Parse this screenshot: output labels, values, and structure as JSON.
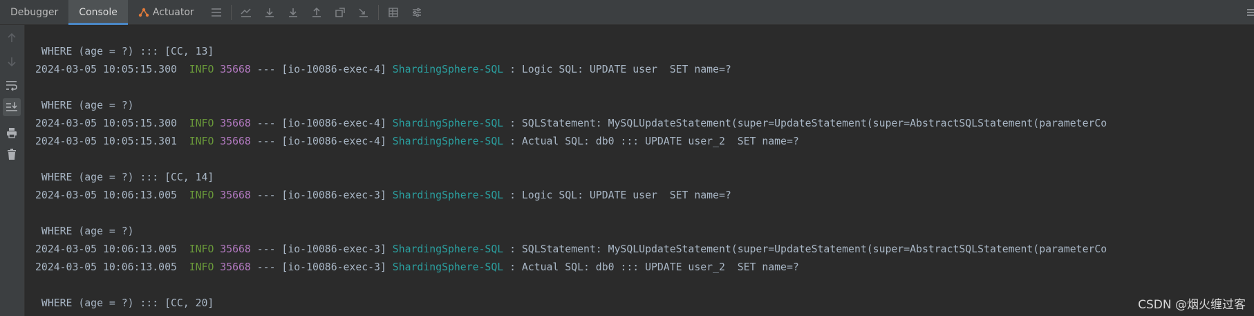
{
  "tabs": {
    "debugger": "Debugger",
    "console": "Console",
    "actuator": "Actuator"
  },
  "colors": {
    "background": "#2b2b2b",
    "info": "#6a9a3a",
    "pid": "#b279c0",
    "logger": "#2aa0a0",
    "text": "#a9b7c6",
    "active_tab_underline": "#4a88c7"
  },
  "toolbar_icons": [
    "menu-icon",
    "restore-layout-icon",
    "step-over-icon",
    "step-into-icon",
    "step-out-icon",
    "run-to-cursor-icon",
    "evaluate-icon",
    "table-icon",
    "settings-list-icon"
  ],
  "gutter_icons": [
    "up-arrow-icon",
    "down-arrow-icon",
    "soft-wrap-icon",
    "scroll-to-end-icon",
    "print-icon",
    "trash-icon"
  ],
  "log": {
    "lines": [
      {
        "type": "text",
        "text": " WHERE (age = ?) ::: [CC, 13]"
      },
      {
        "type": "log",
        "ts": "2024-03-05 10:05:15.300",
        "level": "INFO",
        "pid": "35668",
        "sep": "---",
        "thread": "[io-10086-exec-4]",
        "logger": "ShardingSphere-SQL",
        "msg": ": Logic SQL: UPDATE user  SET name=?"
      },
      {
        "type": "blank",
        "text": ""
      },
      {
        "type": "text",
        "text": " WHERE (age = ?)"
      },
      {
        "type": "log",
        "ts": "2024-03-05 10:05:15.300",
        "level": "INFO",
        "pid": "35668",
        "sep": "---",
        "thread": "[io-10086-exec-4]",
        "logger": "ShardingSphere-SQL",
        "msg": ": SQLStatement: MySQLUpdateStatement(super=UpdateStatement(super=AbstractSQLStatement(parameterCo"
      },
      {
        "type": "log",
        "ts": "2024-03-05 10:05:15.301",
        "level": "INFO",
        "pid": "35668",
        "sep": "---",
        "thread": "[io-10086-exec-4]",
        "logger": "ShardingSphere-SQL",
        "msg": ": Actual SQL: db0 ::: UPDATE user_2  SET name=?"
      },
      {
        "type": "blank",
        "text": ""
      },
      {
        "type": "text",
        "text": " WHERE (age = ?) ::: [CC, 14]"
      },
      {
        "type": "log",
        "ts": "2024-03-05 10:06:13.005",
        "level": "INFO",
        "pid": "35668",
        "sep": "---",
        "thread": "[io-10086-exec-3]",
        "logger": "ShardingSphere-SQL",
        "msg": ": Logic SQL: UPDATE user  SET name=?"
      },
      {
        "type": "blank",
        "text": ""
      },
      {
        "type": "text",
        "text": " WHERE (age = ?)"
      },
      {
        "type": "log",
        "ts": "2024-03-05 10:06:13.005",
        "level": "INFO",
        "pid": "35668",
        "sep": "---",
        "thread": "[io-10086-exec-3]",
        "logger": "ShardingSphere-SQL",
        "msg": ": SQLStatement: MySQLUpdateStatement(super=UpdateStatement(super=AbstractSQLStatement(parameterCo"
      },
      {
        "type": "log",
        "ts": "2024-03-05 10:06:13.005",
        "level": "INFO",
        "pid": "35668",
        "sep": "---",
        "thread": "[io-10086-exec-3]",
        "logger": "ShardingSphere-SQL",
        "msg": ": Actual SQL: db0 ::: UPDATE user_2  SET name=?"
      },
      {
        "type": "blank",
        "text": ""
      },
      {
        "type": "text",
        "text": " WHERE (age = ?) ::: [CC, 20]"
      }
    ]
  },
  "watermark": "CSDN @烟火缠过客"
}
